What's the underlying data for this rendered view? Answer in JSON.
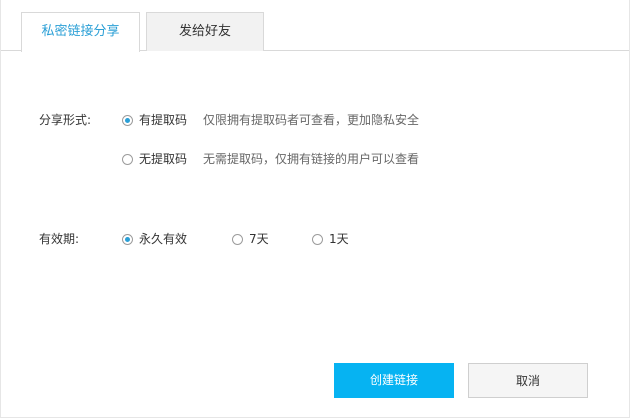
{
  "tabs": [
    {
      "label": "私密链接分享",
      "active": true
    },
    {
      "label": "发给好友",
      "active": false
    }
  ],
  "share_form": {
    "label": "分享形式:",
    "options": [
      {
        "label": "有提取码",
        "hint": "仅限拥有提取码者可查看，更加隐私安全",
        "selected": true
      },
      {
        "label": "无提取码",
        "hint": "无需提取码，仅拥有链接的用户可以查看",
        "selected": false
      }
    ]
  },
  "validity": {
    "label": "有效期:",
    "options": [
      {
        "label": "永久有效",
        "selected": true
      },
      {
        "label": "7天",
        "selected": false
      },
      {
        "label": "1天",
        "selected": false
      }
    ]
  },
  "buttons": {
    "create": "创建链接",
    "cancel": "取消"
  },
  "colors": {
    "accent": "#2a9fd6",
    "primary_button": "#06b3f2"
  }
}
